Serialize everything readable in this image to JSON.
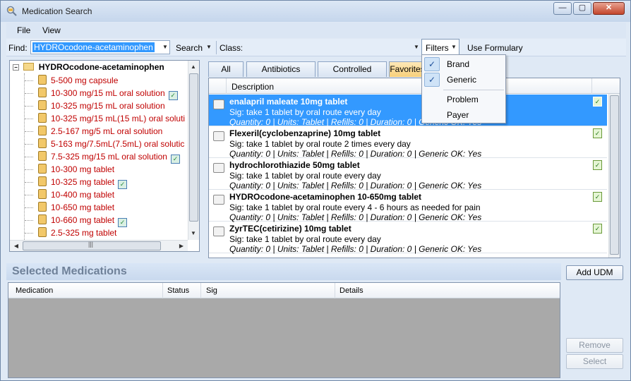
{
  "window": {
    "title": "Medication Search",
    "controls": {
      "minimize": "—",
      "maximize": "▢",
      "close": "✕"
    }
  },
  "menu": {
    "items": [
      "File",
      "View"
    ]
  },
  "toolbar": {
    "find_label": "Find:",
    "find_value": "HYDROcodone-acetaminophen",
    "search_label": "Search",
    "class_label": "Class:",
    "class_value": "",
    "filters_label": "Filters",
    "use_formulary_label": "Use Formulary"
  },
  "filters_menu": {
    "items": [
      {
        "label": "Brand",
        "checked": true
      },
      {
        "label": "Generic",
        "checked": true
      },
      {
        "label": "Problem",
        "checked": false
      },
      {
        "label": "Payer",
        "checked": false
      }
    ]
  },
  "tree": {
    "root": "HYDROcodone-acetaminophen",
    "items": [
      {
        "label": "5-500 mg capsule",
        "formulary": false
      },
      {
        "label": "10-300 mg/15 mL oral solution",
        "formulary": true
      },
      {
        "label": "10-325 mg/15 mL oral solution",
        "formulary": false
      },
      {
        "label": "10-325 mg/15 mL(15 mL) oral soluti",
        "formulary": false
      },
      {
        "label": "2.5-167 mg/5 mL oral solution",
        "formulary": false
      },
      {
        "label": "5-163 mg/7.5mL(7.5mL) oral solutic",
        "formulary": false
      },
      {
        "label": "7.5-325 mg/15 mL oral solution",
        "formulary": true
      },
      {
        "label": "10-300 mg tablet",
        "formulary": false
      },
      {
        "label": "10-325 mg tablet",
        "formulary": true
      },
      {
        "label": "10-400 mg tablet",
        "formulary": false
      },
      {
        "label": "10-650 mg tablet",
        "formulary": false
      },
      {
        "label": "10-660 mg tablet",
        "formulary": true
      },
      {
        "label": "2.5-325 mg tablet",
        "formulary": false
      }
    ]
  },
  "tabs": [
    {
      "label": "All",
      "active": false
    },
    {
      "label": "Antibiotics",
      "active": false
    },
    {
      "label": "Controlled",
      "active": false
    },
    {
      "label": "Favorites",
      "active": true
    }
  ],
  "med_list": {
    "column_description": "Description",
    "rows": [
      {
        "name": "enalapril maleate 10mg tablet",
        "sig": "Sig: take 1 tablet by oral route  every day",
        "details": "Quantity: 0 | Units: Tablet | Refills: 0 | Duration: 0 | Generic OK: Yes",
        "selected": true
      },
      {
        "name": "Flexeril(cyclobenzaprine) 10mg tablet",
        "sig": "Sig: take 1 tablet by oral route 2 times every day",
        "details": "Quantity: 0 | Units: Tablet | Refills: 0 | Duration: 0 | Generic OK: Yes",
        "selected": false
      },
      {
        "name": "hydrochlorothiazide 50mg tablet",
        "sig": "Sig: take 1 tablet by oral route  every day",
        "details": "Quantity: 0 | Units: Tablet | Refills: 0 | Duration: 0 | Generic OK: Yes",
        "selected": false
      },
      {
        "name": "HYDROcodone-acetaminophen 10-650mg tablet",
        "sig": "Sig: take 1 tablet by oral route  every 4 - 6 hours as needed for pain",
        "details": "Quantity: 0 | Units: Tablet | Refills: 0 | Duration: 0 | Generic OK: Yes",
        "selected": false
      },
      {
        "name": "ZyrTEC(cetirizine) 10mg tablet",
        "sig": "Sig: take 1 tablet by oral route  every day",
        "details": "Quantity: 0 | Units: Tablet | Refills: 0 | Duration: 0 | Generic OK: Yes",
        "selected": false
      }
    ]
  },
  "selected_meds": {
    "title": "Selected Medications",
    "columns": [
      "Medication",
      "Status",
      "Sig",
      "Details"
    ]
  },
  "buttons": {
    "add_udm": "Add UDM",
    "remove": "Remove",
    "select": "Select"
  }
}
